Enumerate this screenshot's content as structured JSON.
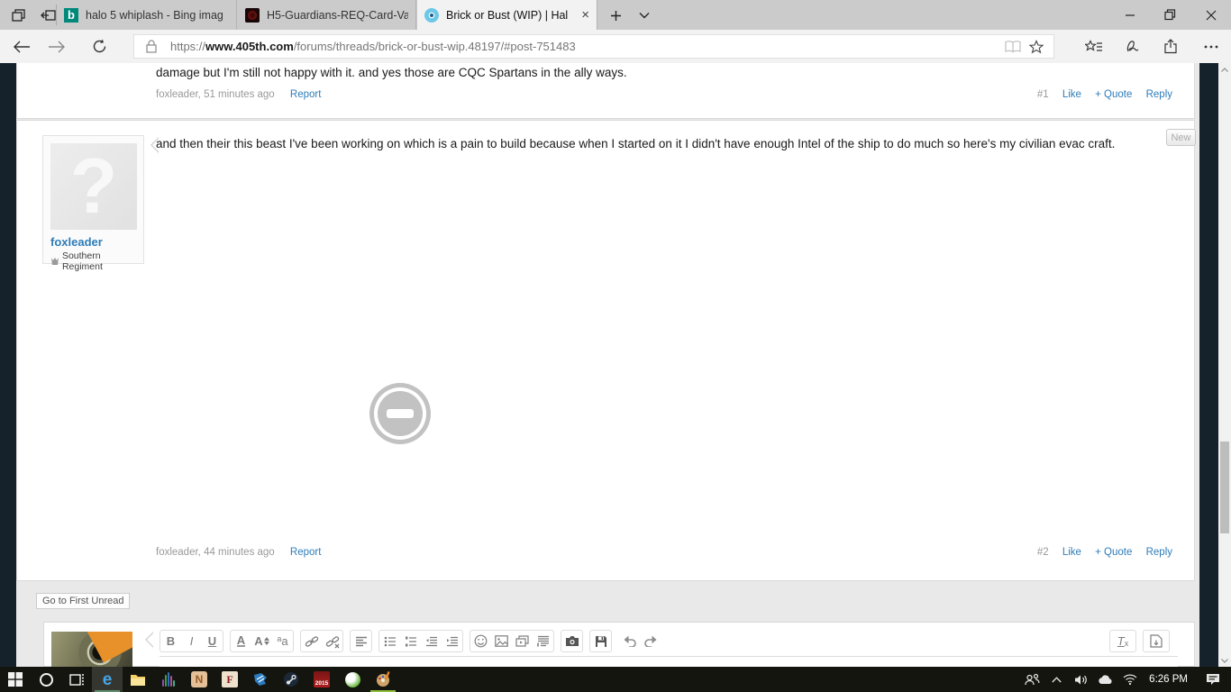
{
  "browser": {
    "tab_bar": {
      "icons": [
        "tab-preview-icon",
        "set-tabs-aside-icon",
        "new-tab-icon",
        "tab-list-chevron-icon"
      ],
      "tabs": [
        {
          "title": "halo 5 whiplash - Bing imag",
          "favicon": "bing-icon",
          "active": false
        },
        {
          "title": "H5-Guardians-REQ-Card-Va",
          "favicon": "req-card-icon",
          "active": false
        },
        {
          "title": "Brick or Bust (WIP) | Hal",
          "favicon": "405th-icon",
          "active": true
        }
      ]
    },
    "window_controls": [
      "minimize-icon",
      "restore-icon",
      "close-icon"
    ],
    "address_bar": {
      "icons": [
        "back-icon",
        "forward-icon",
        "refresh-icon",
        "lock-icon",
        "reading-view-icon",
        "favorite-star-icon",
        "hub-icon",
        "web-note-icon",
        "share-icon",
        "more-icon"
      ],
      "protocol": "https://",
      "domain": "www.405th.com",
      "path": "/forums/threads/brick-or-bust-wip.48197/#post-751483"
    }
  },
  "forum": {
    "posts": [
      {
        "body": "damage but I'm still not happy with it. and yes those are CQC Spartans in the ally ways.",
        "byline": "foxleader, 51 minutes ago",
        "report": "Report",
        "number": "#1",
        "like": "Like",
        "quote": "+ Quote",
        "reply": "Reply"
      },
      {
        "author": "foxleader",
        "author_badge": "Southern Regiment",
        "avatar_glyph": "?",
        "new_badge": "New",
        "body": "and then their this beast I've been working on which is a pain to build because when I started on it I didn't have enough Intel of the ship to do much so here's my civilian evac craft.",
        "broken_image_icon": "broken-image-icon",
        "byline": "foxleader, 44 minutes ago",
        "report": "Report",
        "number": "#2",
        "like": "Like",
        "quote": "+ Quote",
        "reply": "Reply"
      }
    ],
    "go_to_first_unread": "Go to First Unread"
  },
  "editor": {
    "glyphs": {
      "bold": "B",
      "italic": "I",
      "underline": "U",
      "color": "A",
      "size": "A",
      "fam_small": "a",
      "fam_big": "a",
      "t": "T",
      "x": "x"
    },
    "toolbar_icons": [
      "bold",
      "italic",
      "underline",
      "text-color",
      "font-size",
      "font-family",
      "insert-link",
      "unlink",
      "alignment",
      "bullet-list",
      "numbered-list",
      "outdent",
      "indent",
      "smilies",
      "insert-image",
      "insert-media",
      "insert-quote",
      "gallery-camera",
      "save-draft",
      "undo",
      "redo",
      "remove-formatting",
      "bb-code"
    ]
  },
  "scrollbar": {
    "icons": [
      "scroll-up-icon",
      "scroll-down-icon"
    ]
  },
  "taskbar": {
    "apps": [
      "start",
      "search",
      "task-view",
      "edge",
      "file-explorer",
      "media-app",
      "nexus-app",
      "f-app",
      "blue-app",
      "steam",
      "cad-2015-app",
      "green-app",
      "paint-app"
    ],
    "app_2015_label": "2015",
    "edge_glyph": "e",
    "nexus_glyph": "N",
    "f_glyph": "F",
    "tray_icons": [
      "people-icon",
      "hidden-icons-chevron",
      "volume-icon",
      "onedrive-cloud-icon",
      "wifi-icon",
      "action-center-icon"
    ],
    "clock": "6:26 PM"
  },
  "colors": {
    "link_blue": "#2e7cb8",
    "page_dark": "#16222b",
    "accent_green": "#8fbf3f",
    "taskbar_black": "#15150f"
  }
}
